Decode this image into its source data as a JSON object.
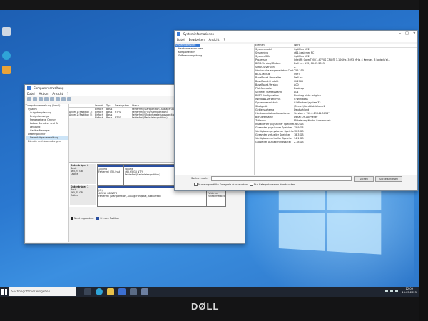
{
  "taskbar": {
    "search_placeholder": "Suchbegriff hier eingeben",
    "time": "12:09",
    "date": "15.05.2025"
  },
  "monitor": {
    "brand": "DØLL"
  },
  "computer_mgmt": {
    "title": "Computerverwaltung",
    "menu": [
      "Datei",
      "Aktion",
      "Ansicht",
      "?"
    ],
    "tree": [
      "Computerverwaltung (Lokal)",
      "System",
      "Aufgabenplanung",
      "Ereignisanzeige",
      "Freigegebene Ordner",
      "Lokale Benutzer und Gr",
      "Leistung",
      "Geräte-Manager",
      "Datenspeicher",
      "Datenträgerverwaltung",
      "Dienste und Anwendungen"
    ],
    "table_headers": [
      "Layout",
      "Typ",
      "Dateisystem",
      "Status"
    ],
    "volumes": [
      [
        "",
        "Einfach",
        "Basis",
        "",
        "Fehlerfrei (Startpartition, Auslagerungsd"
      ],
      [
        "Anger 1 (Partition 1)",
        "Einfach",
        "Basis",
        "NTFS",
        "Fehlerfrei (EFI-Systempartition)"
      ],
      [
        "Anger 2 (Partition 5)",
        "Einfach",
        "Basis",
        "",
        "Fehlerfrei (Wiederherstellungspartition)"
      ],
      [
        "",
        "Einfach",
        "Basis",
        "NTFS",
        "Fehlerfrei (Basisdatenpartition)"
      ]
    ],
    "disk0": {
      "label": "Datenträger 0",
      "info": [
        "Basis",
        "465,75 GB",
        "Online"
      ],
      "parts": [
        [
          "100 MB",
          "Fehlerfrei (EFI-Syst"
        ],
        [
          "Volume",
          "465,65 GB NTFS",
          "Fehlerfrei (Basisdatenpartition)"
        ]
      ]
    },
    "disk1": {
      "label": "Datenträger 1",
      "info": [
        "Basis",
        "465,75 GB",
        "Online"
      ],
      "parts": [
        [
          "(C:)",
          "465,18 GB NTFS",
          "Fehlerfrei (Startpartition, Auslagerungsdat, Absturzabb"
        ],
        [
          "551 MB",
          "Fehlerfrei (Wiederherstell"
        ]
      ]
    },
    "legend": [
      "Nicht zugeordnet",
      "Primäre Partition"
    ]
  },
  "sysinfo": {
    "title": "Systeminformationen",
    "menu": [
      "Datei",
      "Bearbeiten",
      "Ansicht",
      "?"
    ],
    "tree": [
      "Systemübersicht",
      "Hardwareressourcen",
      "Komponenten",
      "Softwareumgebung"
    ],
    "headers": [
      "Element",
      "Wert"
    ],
    "rows": [
      [
        "Systemmodell",
        "OptiPlex XE2"
      ],
      [
        "Systemtyp",
        "x64-basierter PC"
      ],
      [
        "System-SKU",
        "OptiPlex XE2"
      ],
      [
        "Prozessor",
        "Intel(R) Core(TM) i7-4770S CPU @ 3.10GHz, 3093 MHz, 4 Kern(e), 8 logisch(e)..."
      ],
      [
        "BIOS-Version/-Datum",
        "Dell Inc. A12, 06.05.2015"
      ],
      [
        "SMBIOS-Version",
        "2.7"
      ],
      [
        "Version des eingebetteten Cont...",
        "255.255"
      ],
      [
        "BIOS-Modus",
        "UEFI"
      ],
      [
        "BaseBoard-Hersteller",
        "Dell Inc."
      ],
      [
        "BaseBoard-Produkt",
        "0X2765"
      ],
      [
        "BaseBoard-Version",
        "A00"
      ],
      [
        "Plattformrolle",
        "Desktop"
      ],
      [
        "Sicherer Startzustand",
        "Aus"
      ],
      [
        "PCR7-Konfiguration",
        "Bindung nicht möglich"
      ],
      [
        "Windows-Verzeichnis",
        "C:\\Windows"
      ],
      [
        "Systemverzeichnis",
        "C:\\Windows\\system32"
      ],
      [
        "Startgerät",
        "\\Device\\HarddiskVolume1"
      ],
      [
        "Gebietsschema",
        "Deutschland"
      ],
      [
        "Hardwareabstraktionsebene",
        "Version = \"10.0.19041.5634\""
      ],
      [
        "Benutzername",
        "DESKTOP-1A\\Pfeifer"
      ],
      [
        "Zeitzone",
        "Mitteleuropäische Sommerzeit"
      ],
      [
        "Installierter physischer Speicher...",
        "16,0 GB"
      ],
      [
        "Gesamter physischer Speicher",
        "15,9 GB"
      ],
      [
        "Verfügbarer physischer Speicher",
        "12,3 GB"
      ],
      [
        "Gesamter virtueller Speicher",
        "18,3 GB"
      ],
      [
        "Verfügbarer virtueller Speicher",
        "14,1 GB"
      ],
      [
        "Größe der Auslagerungsdatei",
        "2,38 GB"
      ]
    ],
    "search_label": "Suchen nach:",
    "search_value": "",
    "btn_find": "Suchen",
    "btn_close": "Suche schließen",
    "chk1": "Nur ausgewählte Kategorie durchsuchen",
    "chk2": "Nur Kategorienamen durchsuchen"
  }
}
